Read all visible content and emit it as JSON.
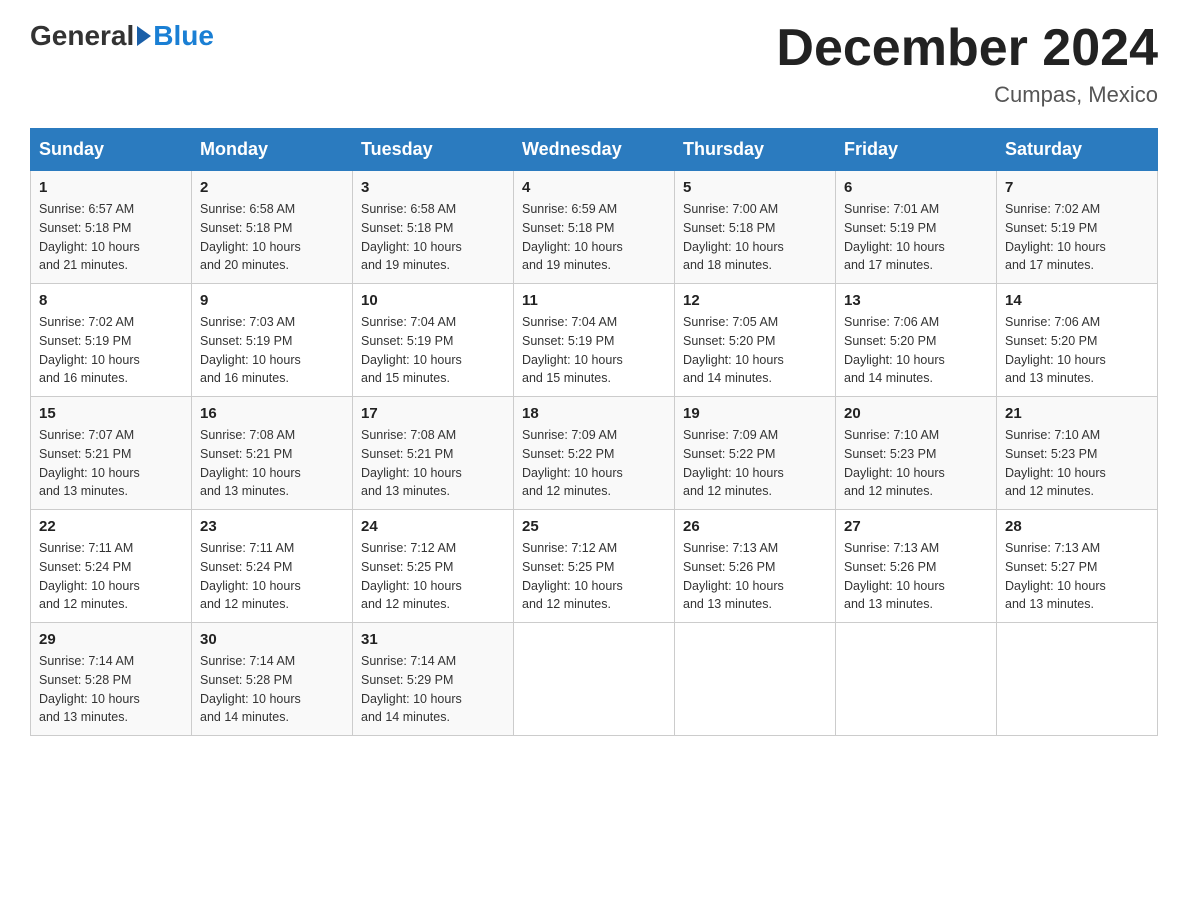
{
  "logo": {
    "general": "General",
    "blue": "Blue",
    "subtitle": ""
  },
  "header": {
    "title": "December 2024",
    "subtitle": "Cumpas, Mexico"
  },
  "days_of_week": [
    "Sunday",
    "Monday",
    "Tuesday",
    "Wednesday",
    "Thursday",
    "Friday",
    "Saturday"
  ],
  "weeks": [
    [
      {
        "day": "1",
        "sunrise": "6:57 AM",
        "sunset": "5:18 PM",
        "daylight": "10 hours and 21 minutes."
      },
      {
        "day": "2",
        "sunrise": "6:58 AM",
        "sunset": "5:18 PM",
        "daylight": "10 hours and 20 minutes."
      },
      {
        "day": "3",
        "sunrise": "6:58 AM",
        "sunset": "5:18 PM",
        "daylight": "10 hours and 19 minutes."
      },
      {
        "day": "4",
        "sunrise": "6:59 AM",
        "sunset": "5:18 PM",
        "daylight": "10 hours and 19 minutes."
      },
      {
        "day": "5",
        "sunrise": "7:00 AM",
        "sunset": "5:18 PM",
        "daylight": "10 hours and 18 minutes."
      },
      {
        "day": "6",
        "sunrise": "7:01 AM",
        "sunset": "5:19 PM",
        "daylight": "10 hours and 17 minutes."
      },
      {
        "day": "7",
        "sunrise": "7:02 AM",
        "sunset": "5:19 PM",
        "daylight": "10 hours and 17 minutes."
      }
    ],
    [
      {
        "day": "8",
        "sunrise": "7:02 AM",
        "sunset": "5:19 PM",
        "daylight": "10 hours and 16 minutes."
      },
      {
        "day": "9",
        "sunrise": "7:03 AM",
        "sunset": "5:19 PM",
        "daylight": "10 hours and 16 minutes."
      },
      {
        "day": "10",
        "sunrise": "7:04 AM",
        "sunset": "5:19 PM",
        "daylight": "10 hours and 15 minutes."
      },
      {
        "day": "11",
        "sunrise": "7:04 AM",
        "sunset": "5:19 PM",
        "daylight": "10 hours and 15 minutes."
      },
      {
        "day": "12",
        "sunrise": "7:05 AM",
        "sunset": "5:20 PM",
        "daylight": "10 hours and 14 minutes."
      },
      {
        "day": "13",
        "sunrise": "7:06 AM",
        "sunset": "5:20 PM",
        "daylight": "10 hours and 14 minutes."
      },
      {
        "day": "14",
        "sunrise": "7:06 AM",
        "sunset": "5:20 PM",
        "daylight": "10 hours and 13 minutes."
      }
    ],
    [
      {
        "day": "15",
        "sunrise": "7:07 AM",
        "sunset": "5:21 PM",
        "daylight": "10 hours and 13 minutes."
      },
      {
        "day": "16",
        "sunrise": "7:08 AM",
        "sunset": "5:21 PM",
        "daylight": "10 hours and 13 minutes."
      },
      {
        "day": "17",
        "sunrise": "7:08 AM",
        "sunset": "5:21 PM",
        "daylight": "10 hours and 13 minutes."
      },
      {
        "day": "18",
        "sunrise": "7:09 AM",
        "sunset": "5:22 PM",
        "daylight": "10 hours and 12 minutes."
      },
      {
        "day": "19",
        "sunrise": "7:09 AM",
        "sunset": "5:22 PM",
        "daylight": "10 hours and 12 minutes."
      },
      {
        "day": "20",
        "sunrise": "7:10 AM",
        "sunset": "5:23 PM",
        "daylight": "10 hours and 12 minutes."
      },
      {
        "day": "21",
        "sunrise": "7:10 AM",
        "sunset": "5:23 PM",
        "daylight": "10 hours and 12 minutes."
      }
    ],
    [
      {
        "day": "22",
        "sunrise": "7:11 AM",
        "sunset": "5:24 PM",
        "daylight": "10 hours and 12 minutes."
      },
      {
        "day": "23",
        "sunrise": "7:11 AM",
        "sunset": "5:24 PM",
        "daylight": "10 hours and 12 minutes."
      },
      {
        "day": "24",
        "sunrise": "7:12 AM",
        "sunset": "5:25 PM",
        "daylight": "10 hours and 12 minutes."
      },
      {
        "day": "25",
        "sunrise": "7:12 AM",
        "sunset": "5:25 PM",
        "daylight": "10 hours and 12 minutes."
      },
      {
        "day": "26",
        "sunrise": "7:13 AM",
        "sunset": "5:26 PM",
        "daylight": "10 hours and 13 minutes."
      },
      {
        "day": "27",
        "sunrise": "7:13 AM",
        "sunset": "5:26 PM",
        "daylight": "10 hours and 13 minutes."
      },
      {
        "day": "28",
        "sunrise": "7:13 AM",
        "sunset": "5:27 PM",
        "daylight": "10 hours and 13 minutes."
      }
    ],
    [
      {
        "day": "29",
        "sunrise": "7:14 AM",
        "sunset": "5:28 PM",
        "daylight": "10 hours and 13 minutes."
      },
      {
        "day": "30",
        "sunrise": "7:14 AM",
        "sunset": "5:28 PM",
        "daylight": "10 hours and 14 minutes."
      },
      {
        "day": "31",
        "sunrise": "7:14 AM",
        "sunset": "5:29 PM",
        "daylight": "10 hours and 14 minutes."
      },
      null,
      null,
      null,
      null
    ]
  ],
  "cell_labels": {
    "sunrise": "Sunrise: ",
    "sunset": "Sunset: ",
    "daylight": "Daylight: "
  }
}
